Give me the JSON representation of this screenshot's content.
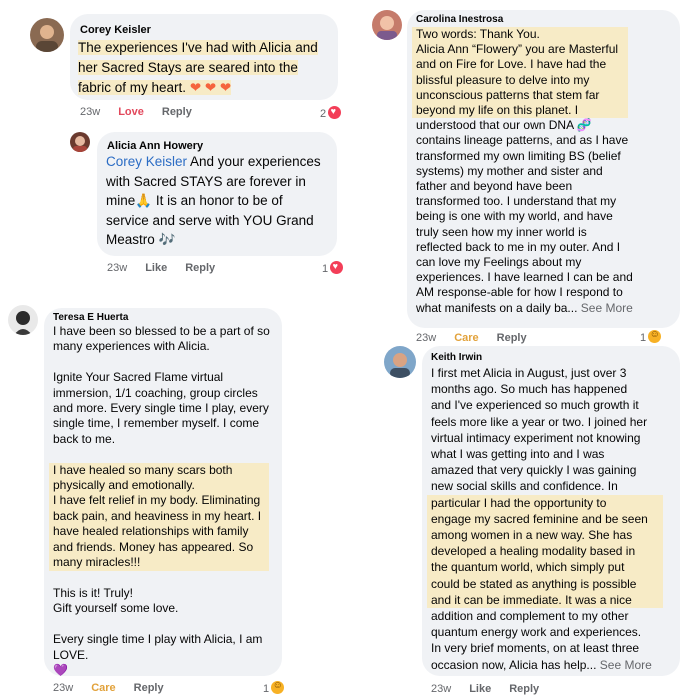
{
  "comments": [
    {
      "author": "Corey Keisler",
      "lines": [
        "The experiences I've had with Alicia and",
        "her Sacred Stays are seared into the",
        "fabric of my heart."
      ],
      "emoji_trail": "❤ ❤ ❤",
      "meta": {
        "age": "23w",
        "reaction_label": "Love",
        "reply": "Reply"
      },
      "reaction_count": "2",
      "reaction_icon": "heart-icon"
    },
    {
      "author": "Alicia Ann Howery",
      "mention": "Corey Keisler",
      "lines": [
        " And your experiences",
        "with Sacred STAYS are forever in",
        "mine🙏 It is an honor to be of",
        "service and  serve with YOU Grand",
        "Meastro 🎶"
      ],
      "meta": {
        "age": "23w",
        "like": "Like",
        "reply": "Reply"
      },
      "reaction_count": "1",
      "reaction_icon": "heart-icon"
    },
    {
      "author": "Teresa E Huerta",
      "lines": [
        "I have been so blessed to be a part of so",
        "many experiences with Alicia.",
        "",
        "Ignite Your Sacred Flame virtual",
        "immersion, 1/1 coaching, group circles",
        "and more. Every single time I play, every",
        "single time, I remember myself. I come",
        "back to me.",
        "",
        "I have healed so many scars both",
        "physically and emotionally.",
        "I have felt relief in my body. Eliminating",
        "back pain, and heaviness in my heart. I",
        "have healed relationships with family",
        "and friends. Money has appeared. So",
        "many miracles!!!",
        "",
        "This is it! Truly!",
        "Gift yourself some love.",
        "",
        "Every single time I play with Alicia, I am",
        "LOVE."
      ],
      "emoji_trail": "💜",
      "meta": {
        "age": "23w",
        "reaction_label": "Care",
        "reply": "Reply"
      },
      "reaction_count": "1",
      "reaction_icon": "care-icon"
    },
    {
      "author": "Carolina Inestrosa",
      "lines": [
        "Two words: Thank You.",
        "Alicia Ann “Flowery” you are Masterful",
        "and on Fire for Love. I have had the",
        "blissful pleasure to delve into my",
        "unconscious patterns that stem far",
        "beyond my life on this planet.  I",
        "understood that our own DNA 🧬",
        "contains lineage patterns, and as I have",
        "transformed my own limiting BS (belief",
        "systems) my mother and sister and",
        "father and beyond have been",
        "transformed too. I understand that my",
        "being is one with my world, and have",
        "truly seen how my inner world is",
        "reflected back to me in my outer. And I",
        "can love my Feelings about my",
        "experiences. I have learned I can be and",
        "AM response-able for how I respond to",
        "what manifests on a daily ba..."
      ],
      "see_more": "See More",
      "meta": {
        "age": "23w",
        "reaction_label": "Care",
        "reply": "Reply"
      },
      "reaction_count": "1",
      "reaction_icon": "care-icon"
    },
    {
      "author": "Keith Irwin",
      "lines": [
        "I first met Alicia in August, just over 3",
        "months ago.  So much has happened",
        "and I've experienced so much growth it",
        "feels more like a year or two.  I joined her",
        "virtual intimacy experiment not knowing",
        "what I was getting into and I was",
        "amazed that very quickly I was gaining",
        "new social skills and confidence.   In",
        "particular I had the opportunity to",
        "engage my sacred feminine and be seen",
        "among women in a new way.  She has",
        "developed a healing modality based in",
        "the quantum world, which simply put",
        "could be stated as anything is possible",
        "and it can be immediate.  It was a nice",
        "addition and complement to my other",
        "quantum energy work and experiences.",
        "In very brief moments, on at least three",
        "occasion now, Alicia has help..."
      ],
      "see_more": "See More",
      "meta": {
        "age": "23w",
        "like": "Like",
        "reply": "Reply"
      }
    }
  ]
}
